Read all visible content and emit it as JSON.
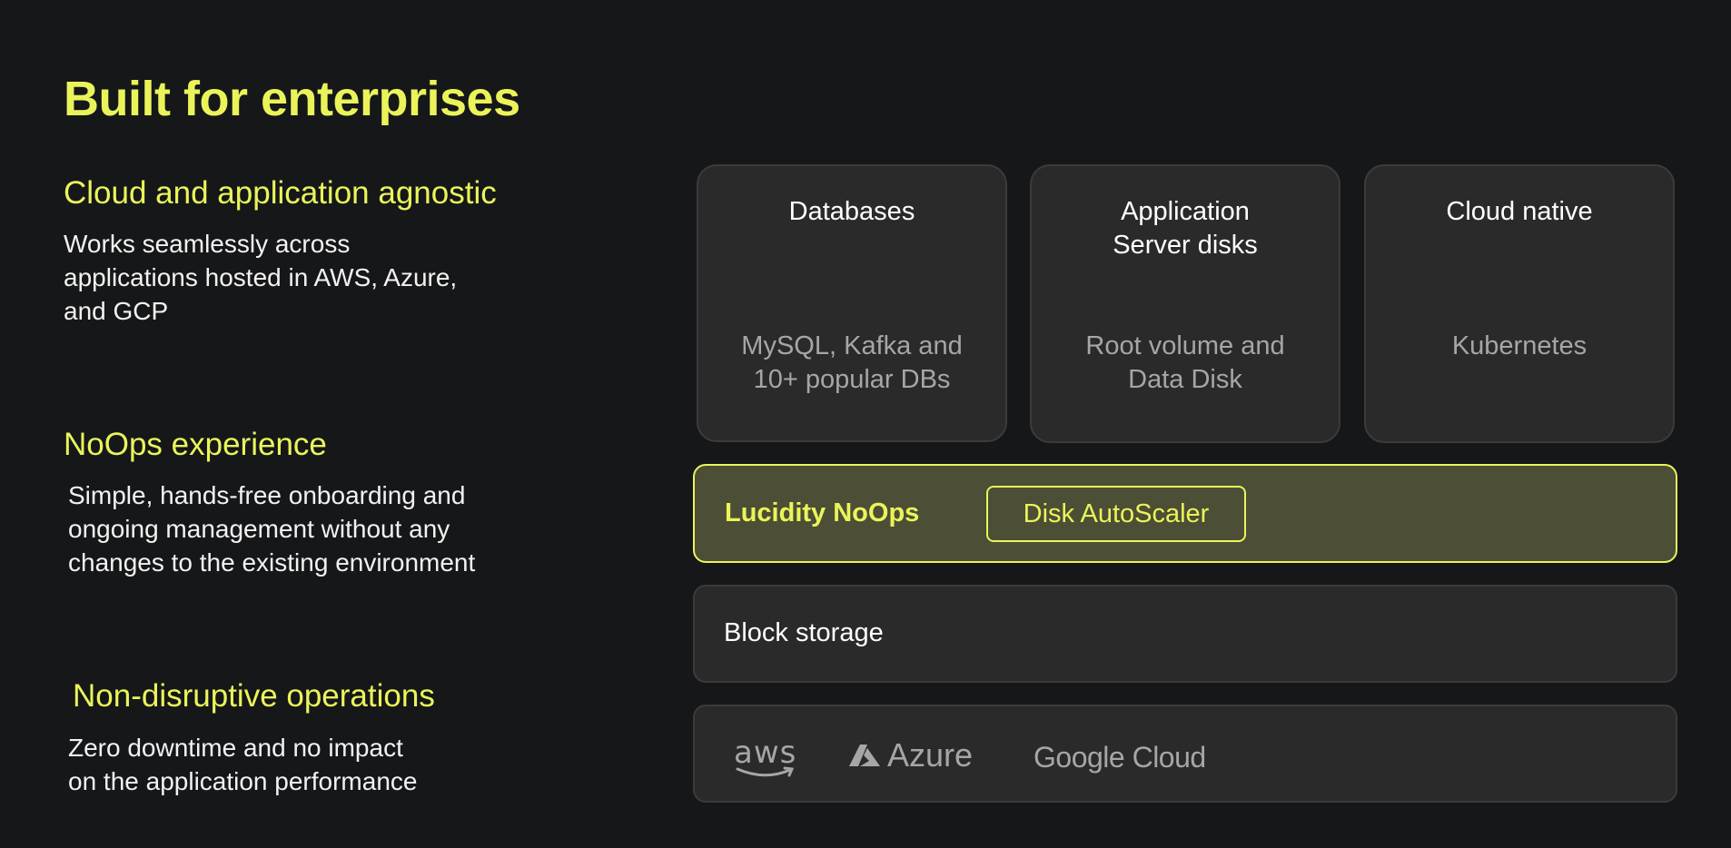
{
  "title": "Built for enterprises",
  "features": [
    {
      "heading": "Cloud and application agnostic",
      "body": "Works seamlessly across\napplications hosted in AWS, Azure,\nand GCP"
    },
    {
      "heading": "NoOps experience",
      "body": "Simple, hands-free onboarding and\nongoing management without any\nchanges to the existing environment"
    },
    {
      "heading": "Non-disruptive operations",
      "body": "Zero downtime and no impact\non the application performance"
    }
  ],
  "diagram": {
    "cards": [
      {
        "title": "Databases",
        "subtitle": "MySQL, Kafka and\n10+ popular DBs"
      },
      {
        "title": "Application\nServer disks",
        "subtitle": "Root volume and\nData Disk"
      },
      {
        "title": "Cloud native",
        "subtitle": "Kubernetes"
      }
    ],
    "noops": {
      "label": "Lucidity NoOps",
      "product": "Disk AutoScaler"
    },
    "block_storage": "Block storage",
    "clouds": {
      "aws": "aws",
      "azure": "Azure",
      "gcp": "Google Cloud"
    }
  },
  "colors": {
    "accent": "#EAF45A",
    "background": "#161719",
    "card": "#2A2A2B",
    "muted": "#A6A6A6"
  }
}
